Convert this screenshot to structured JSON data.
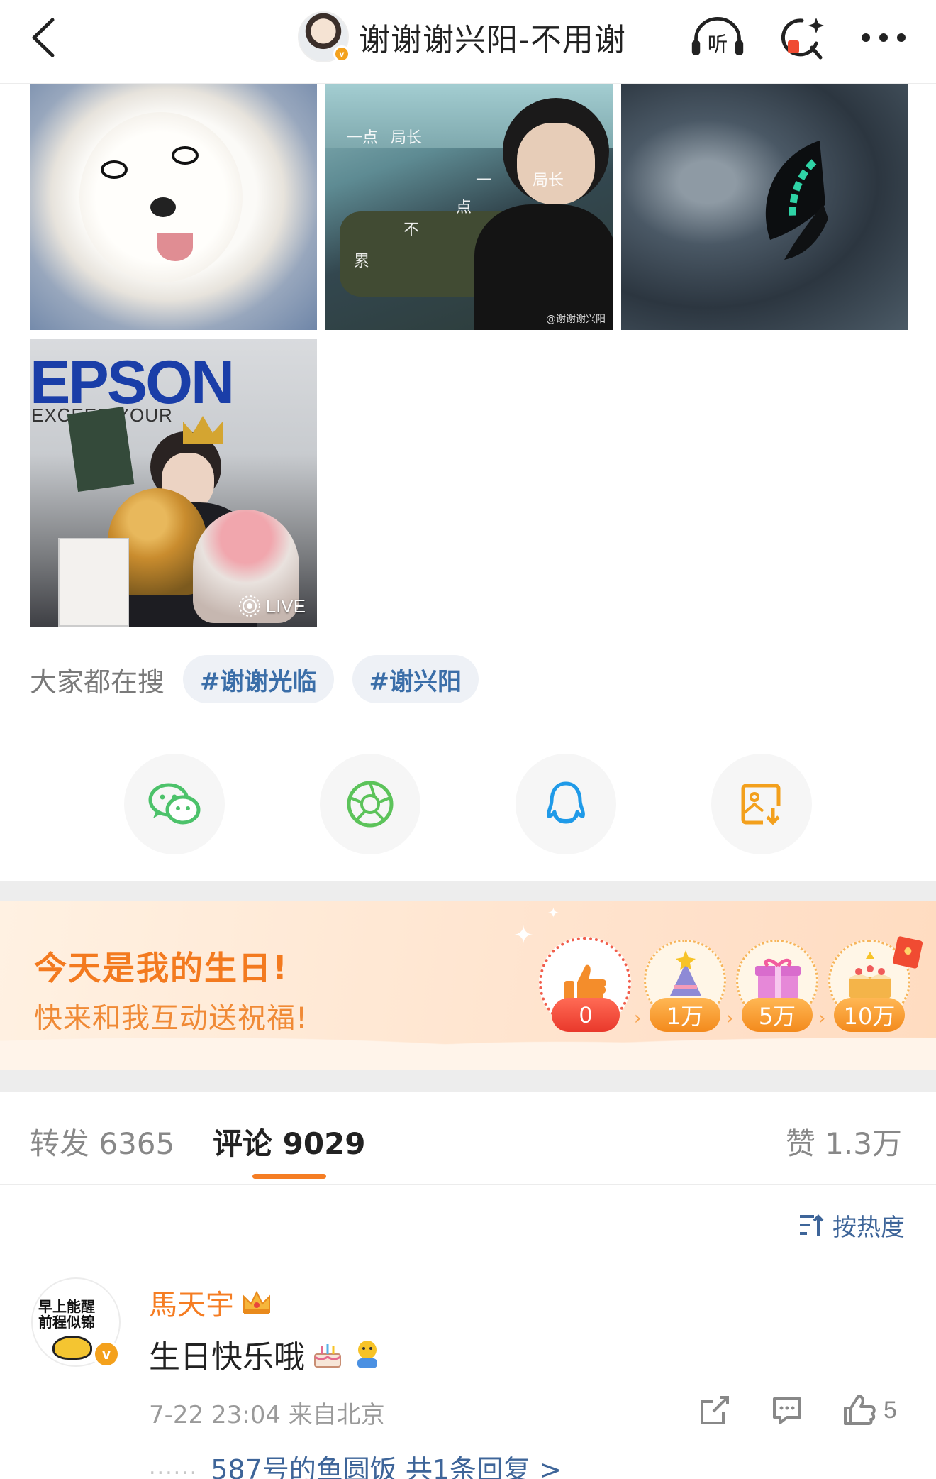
{
  "header": {
    "title": "谢谢谢兴阳-不用谢",
    "verified_badge": "v",
    "icons": [
      "back-icon",
      "listen-icon",
      "search-icon",
      "more-icon"
    ]
  },
  "photos": {
    "live_label": "LIVE",
    "hospital_captions": [
      "一点",
      "局长",
      "不",
      "累",
      "点",
      "一",
      "局长"
    ],
    "hospital_watermark": "@谢谢谢兴阳",
    "epson_brand": "EPSON",
    "epson_tagline": "EXCEED YOUR"
  },
  "trending": {
    "label": "大家都在搜",
    "chips": [
      "#谢谢光临",
      "#谢兴阳"
    ]
  },
  "share": {
    "icons": [
      "wechat-icon",
      "moments-icon",
      "qq-icon",
      "save-image-icon"
    ],
    "colors": {
      "wechat": "#4cc26a",
      "moments": "#5cc35a",
      "qq": "#1f9ae8",
      "save": "#f3a01d"
    }
  },
  "birthday": {
    "title": "今天是我的生日!",
    "subtitle": "快来和我互动送祝福!",
    "like_count": "0",
    "milestones": [
      "1万",
      "5万",
      "10万"
    ]
  },
  "tabs": {
    "repost": "转发 6365",
    "comments": "评论 9029",
    "likes": "赞 1.3万"
  },
  "sort": {
    "label": "按热度"
  },
  "comment": {
    "avatar_text_line1": "早上能醒",
    "avatar_text_line2": "前程似锦",
    "verified_badge": "v",
    "username": "馬天宇",
    "text": "生日快乐哦",
    "meta": "7-22 23:04 来自北京",
    "like_count": "5",
    "reply_dots": "......",
    "reply_preview": "587号的鱼圆饭 共1条回复 >"
  },
  "theme": {
    "accent_orange": "#f57d23",
    "link_blue": "#3e6599",
    "chip_bg": "#eef1f6"
  }
}
